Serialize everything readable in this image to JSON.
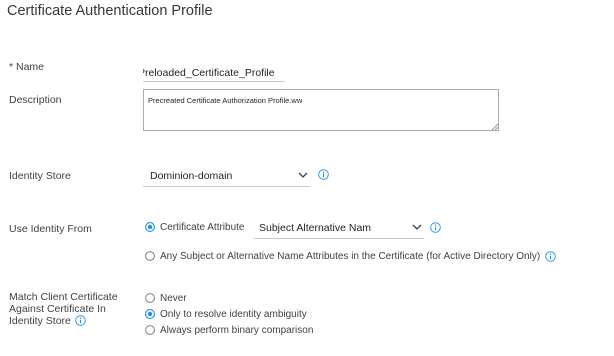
{
  "page": {
    "title": "Certificate Authentication Profile"
  },
  "name_field": {
    "label": "* Name",
    "value": "Preloaded_Certificate_Profile"
  },
  "description_field": {
    "label": "Description",
    "value": "Precreated Certificate Authorization Profile.ww"
  },
  "identity_store": {
    "label": "Identity Store",
    "selected": "Dominion-domain",
    "info_icon": "info-icon"
  },
  "use_identity_from": {
    "label": "Use Identity From",
    "option_certificate_attribute": "Certificate Attribute",
    "attribute_selected": "Subject Alternative Nam",
    "option_any_subject": "Any Subject or Alternative Name Attributes in the Certificate (for Active Directory Only)",
    "selected_option": "Certificate Attribute"
  },
  "match_client_certificate": {
    "label_line1": "Match Client Certificate",
    "label_line2": "Against Certificate In",
    "label_line3": "Identity Store",
    "options": [
      "Never",
      "Only to resolve identity ambiguity",
      "Always perform binary comparison"
    ],
    "selected_option": "Only to resolve identity ambiguity"
  },
  "colors": {
    "accent": "#1f8fe0",
    "border": "#a9aeb4",
    "underline": "#c9ccd0",
    "text": "#3e4247"
  }
}
